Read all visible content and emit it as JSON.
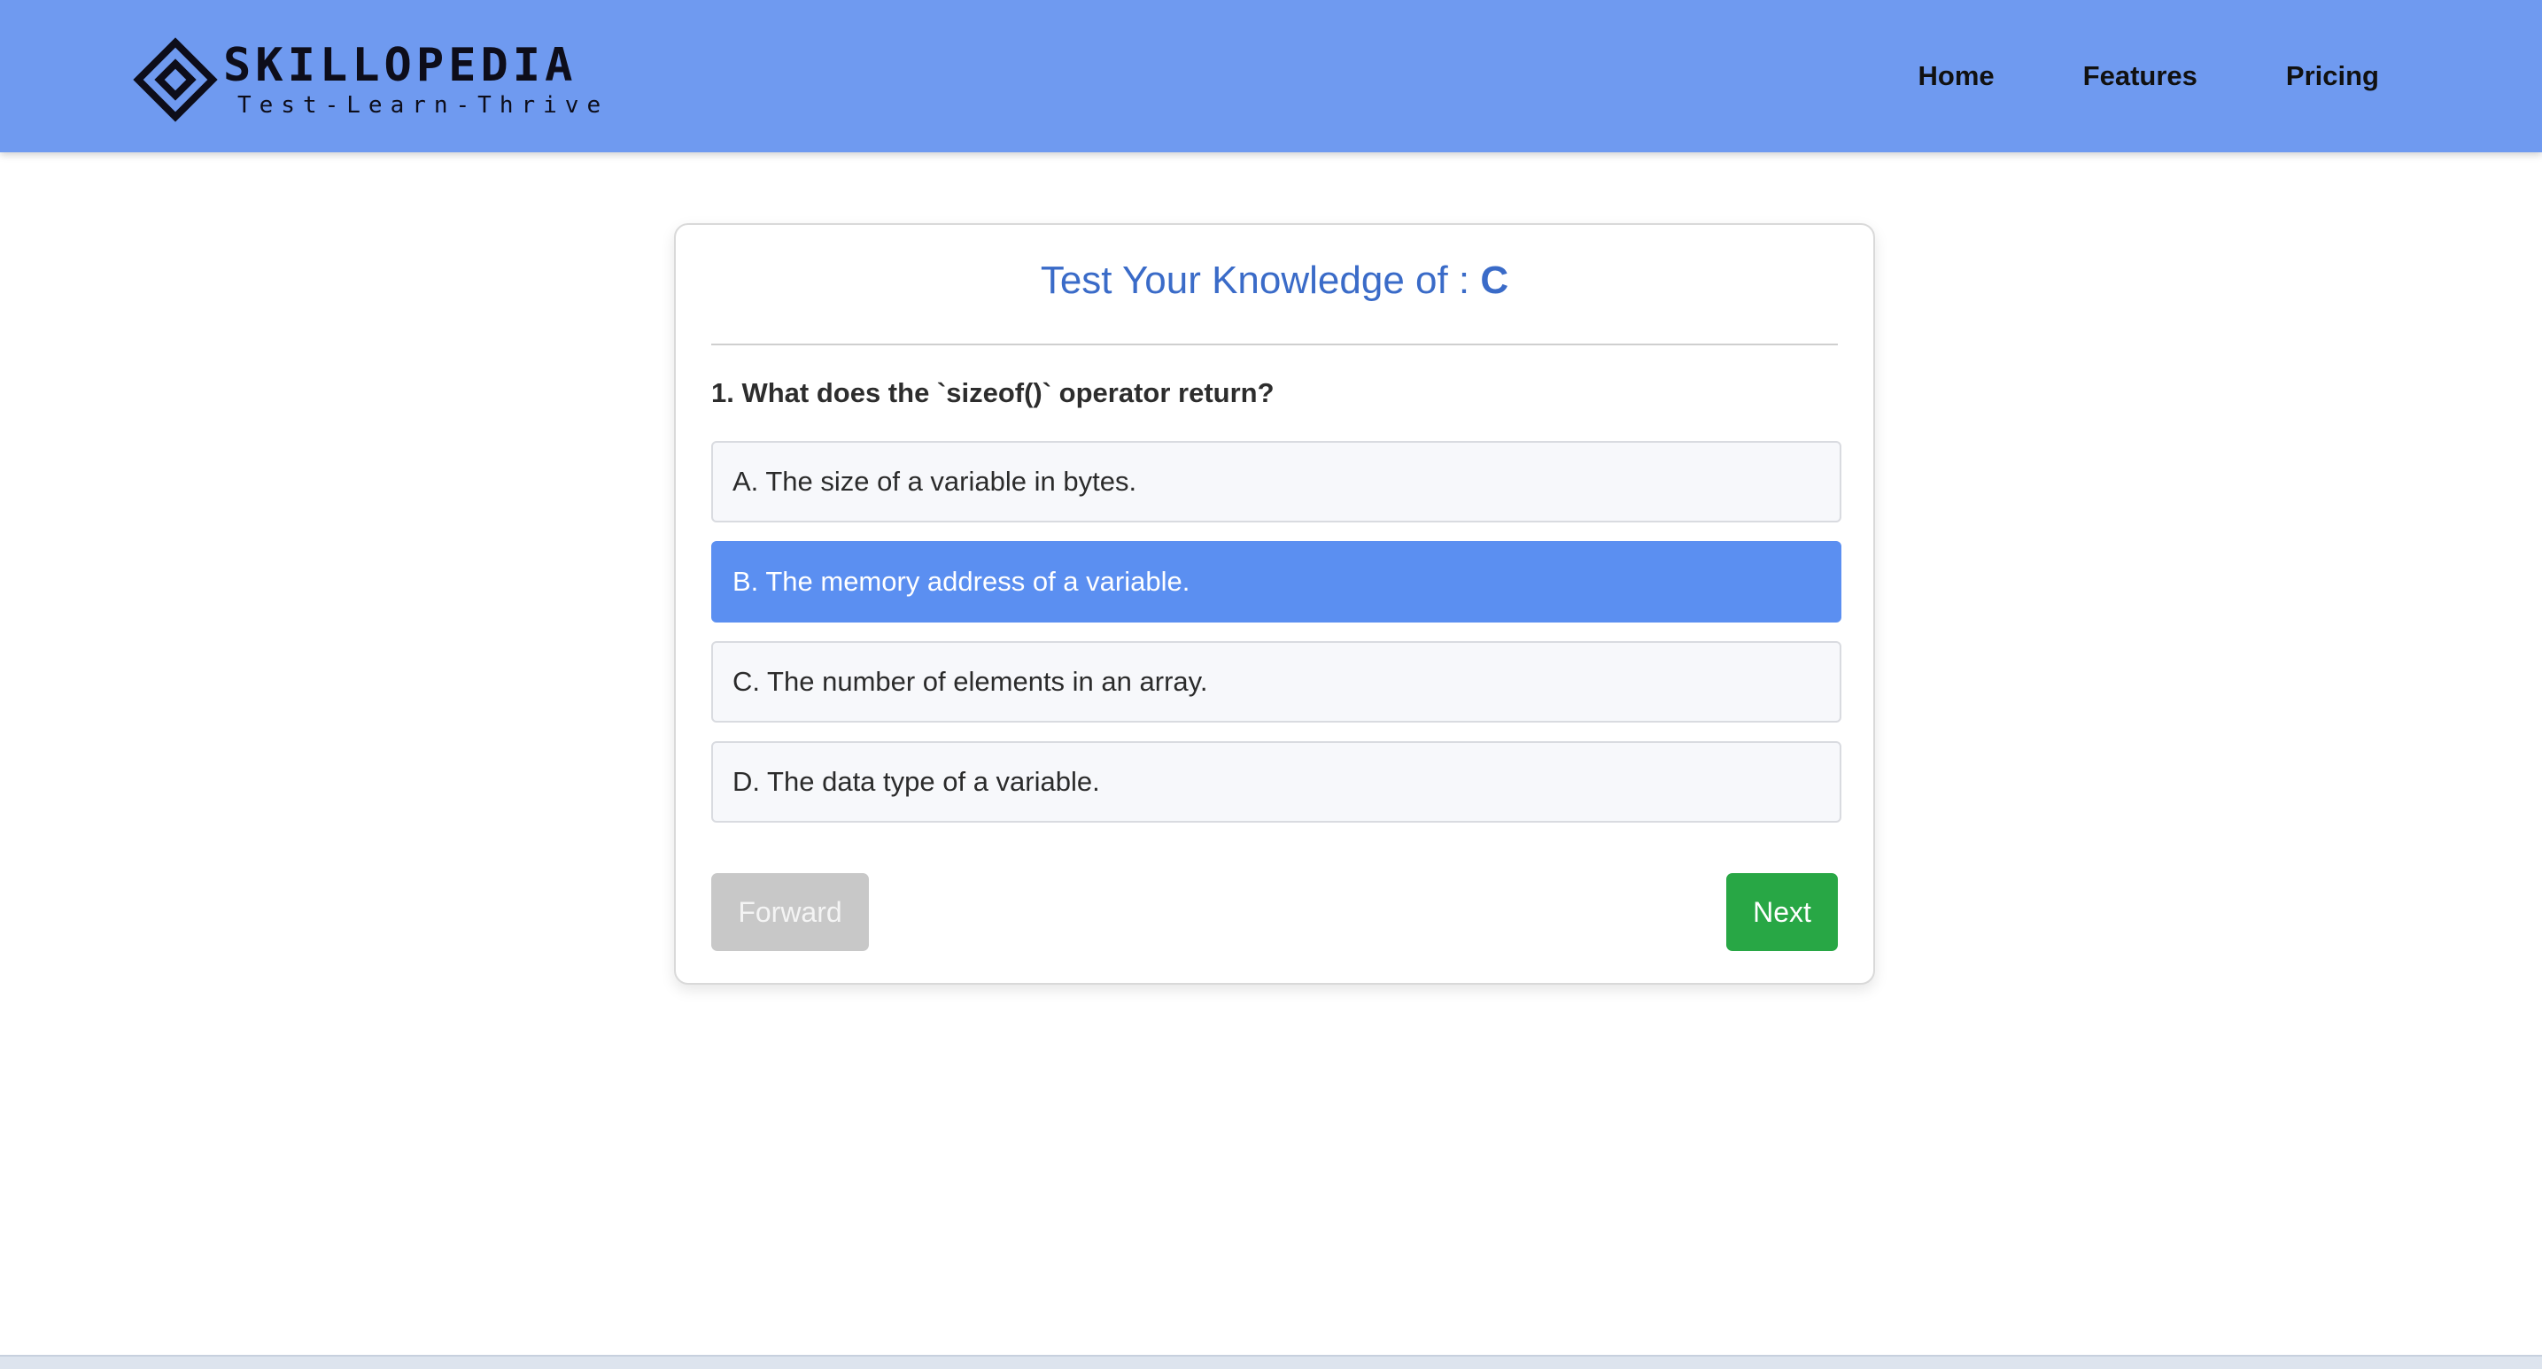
{
  "brand": {
    "name": "SKILLOPEDIA",
    "tagline": "Test-Learn-Thrive"
  },
  "nav": {
    "items": [
      "Home",
      "Features",
      "Pricing"
    ]
  },
  "quiz": {
    "title_prefix": "Test Your Knowledge of : ",
    "subject": "C",
    "question": "1. What does the `sizeof()` operator return?",
    "options": [
      "A. The size of a variable in bytes.",
      "B. The memory address of a variable.",
      "C. The number of elements in an array.",
      "D. The data type of a variable."
    ],
    "selected_option": "B. The memory address of a variable.",
    "forward_label": "Forward",
    "next_label": "Next"
  },
  "colors": {
    "header_bg": "#6f9af0",
    "title": "#3a6bc8",
    "selected_option": "#5b8ff1",
    "next_button": "#28a745",
    "forward_button_disabled": "#c8c8c8"
  }
}
